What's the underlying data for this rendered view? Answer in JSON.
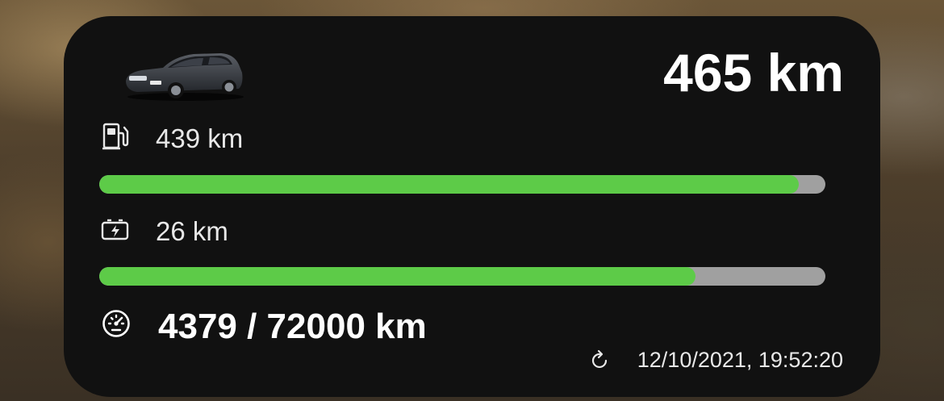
{
  "widget": {
    "total_range": "465 km",
    "car_image": "car-station-wagon-image",
    "fuel": {
      "icon": "fuel-pump-icon",
      "label": "439 km",
      "fill_fraction": 0.963
    },
    "battery": {
      "icon": "battery-charge-icon",
      "label": "26 km",
      "fill_fraction": 0.821
    },
    "odometer": {
      "icon": "speedometer-icon",
      "label": "4379 / 72000 km"
    },
    "updated": {
      "icon": "refresh-icon",
      "label": "12/10/2021, 19:52:20"
    }
  },
  "colors": {
    "widget_background": "#111111",
    "bar_fill": "#5dcb48",
    "bar_track": "#a0a0a0",
    "text_primary": "#ffffff",
    "text_secondary": "#e8e8e8"
  }
}
